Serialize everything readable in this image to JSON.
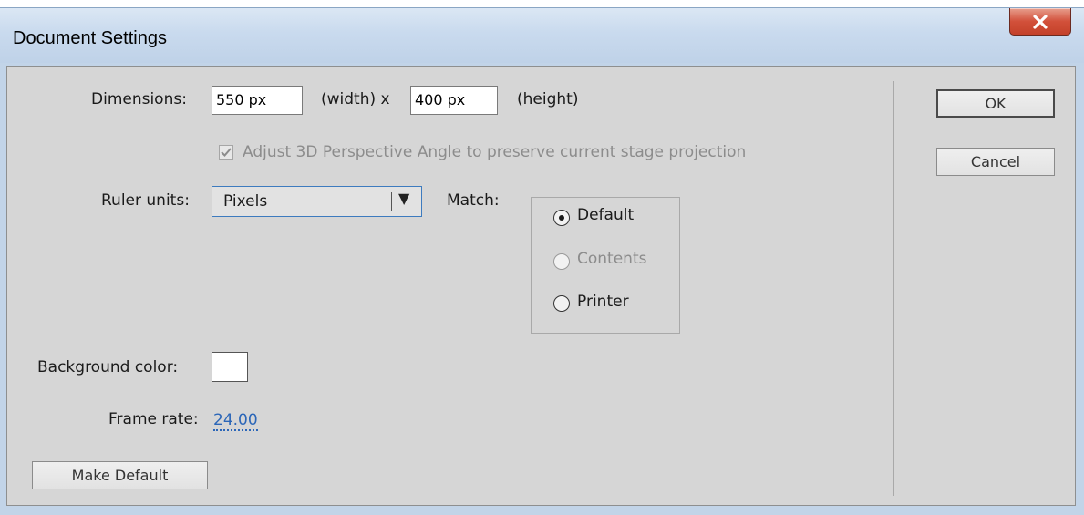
{
  "window": {
    "title": "Document Settings"
  },
  "dimensions": {
    "label": "Dimensions:",
    "width_value": "550 px",
    "width_suffix": "(width) x",
    "height_value": "400 px",
    "height_suffix": "(height)"
  },
  "perspective": {
    "label": "Adjust 3D Perspective Angle to preserve current stage projection",
    "checked": true,
    "enabled": false
  },
  "ruler": {
    "label": "Ruler units:",
    "selected": "Pixels"
  },
  "match": {
    "label": "Match:",
    "options": [
      {
        "label": "Default",
        "selected": true,
        "enabled": true
      },
      {
        "label": "Contents",
        "selected": false,
        "enabled": false
      },
      {
        "label": "Printer",
        "selected": false,
        "enabled": true
      }
    ]
  },
  "background": {
    "label": "Background color:",
    "color": "#ffffff"
  },
  "frame_rate": {
    "label": "Frame rate:",
    "value": "24.00"
  },
  "buttons": {
    "make_default": "Make Default",
    "ok": "OK",
    "cancel": "Cancel"
  },
  "colors": {
    "accent": "#2b66b8",
    "panel": "#d6d6d6",
    "close": "#c4412a"
  }
}
